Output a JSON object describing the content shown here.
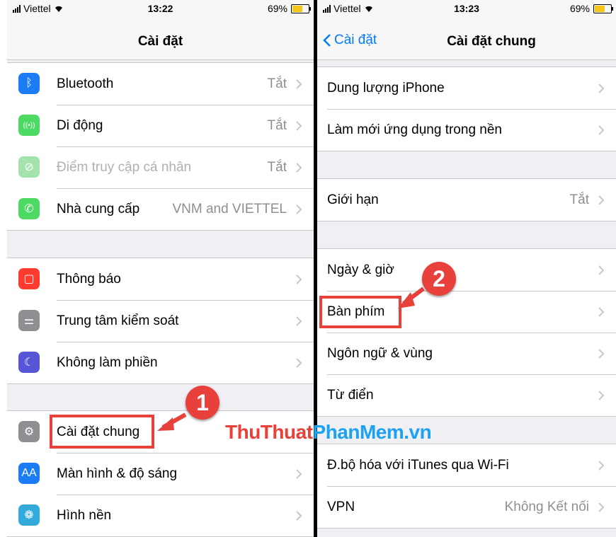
{
  "status_left": {
    "carrier": "Viettel",
    "time": "13:22",
    "battery": "69%"
  },
  "status_right": {
    "carrier": "Viettel",
    "time": "13:23",
    "battery": "69%"
  },
  "left_nav": {
    "title": "Cài đặt"
  },
  "right_nav": {
    "title": "Cài đặt chung",
    "back": "Cài đặt"
  },
  "left_groups": [
    {
      "rows": [
        {
          "label": "Bluetooth",
          "value": "Tắt",
          "icon": "bluetooth-icon",
          "color": "#1c7cf4",
          "glyph": "ᛒ"
        },
        {
          "label": "Di động",
          "value": "Tắt",
          "icon": "cellular-icon",
          "color": "#4cd964",
          "glyph": "((•))"
        },
        {
          "label": "Điểm truy cập cá nhân",
          "value": "Tắt",
          "icon": "hotspot-icon",
          "color": "#a4e3ae",
          "glyph": "⊘",
          "dim": true
        },
        {
          "label": "Nhà cung cấp",
          "value": "VNM and VIETTEL",
          "icon": "phone-icon",
          "color": "#4cd964",
          "glyph": "✆"
        }
      ]
    },
    {
      "rows": [
        {
          "label": "Thông báo",
          "value": "",
          "icon": "notifications-icon",
          "color": "#ff3b30",
          "glyph": "▢"
        },
        {
          "label": "Trung tâm kiểm soát",
          "value": "",
          "icon": "control-center-icon",
          "color": "#8e8e93",
          "glyph": "⚌"
        },
        {
          "label": "Không làm phiền",
          "value": "",
          "icon": "moon-icon",
          "color": "#5856d6",
          "glyph": "☾"
        }
      ]
    },
    {
      "rows": [
        {
          "label": "Cài đặt chung",
          "value": "",
          "icon": "gear-icon",
          "color": "#8e8e93",
          "glyph": "⚙"
        },
        {
          "label": "Màn hình & độ sáng",
          "value": "",
          "icon": "display-icon",
          "color": "#1c7cf4",
          "glyph": "AA"
        },
        {
          "label": "Hình nền",
          "value": "",
          "icon": "wallpaper-icon",
          "color": "#34aadc",
          "glyph": "❁"
        }
      ]
    }
  ],
  "right_groups": [
    {
      "rows": [
        {
          "label": "Dung lượng iPhone",
          "value": ""
        },
        {
          "label": "Làm mới ứng dụng trong nền",
          "value": ""
        }
      ]
    },
    {
      "rows": [
        {
          "label": "Giới hạn",
          "value": "Tắt"
        }
      ]
    },
    {
      "rows": [
        {
          "label": "Ngày & giờ",
          "value": ""
        },
        {
          "label": "Bàn phím",
          "value": ""
        },
        {
          "label": "Ngôn ngữ & vùng",
          "value": ""
        },
        {
          "label": "Từ điển",
          "value": ""
        }
      ]
    },
    {
      "rows": [
        {
          "label": "Đ.bộ hóa với iTunes qua Wi-Fi",
          "value": ""
        },
        {
          "label": "VPN",
          "value": "Không Kết nối"
        }
      ]
    }
  ],
  "annotations": {
    "step1": "1",
    "step2": "2",
    "accent": "#e8403a"
  },
  "watermark": {
    "part1": "ThuThuat",
    "part2": "PhanMem.vn"
  }
}
